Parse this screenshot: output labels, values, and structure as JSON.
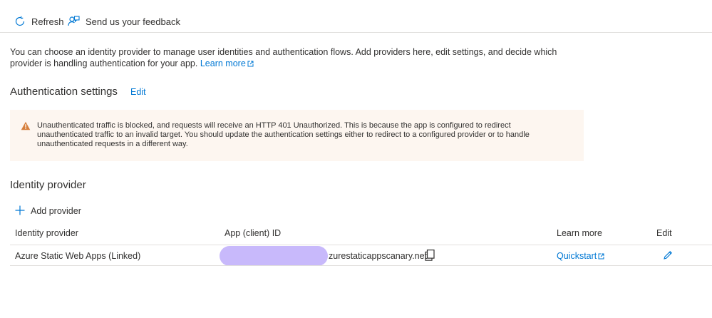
{
  "toolbar": {
    "refresh_label": "Refresh",
    "feedback_label": "Send us your feedback"
  },
  "intro": {
    "text": "You can choose an identity provider to manage user identities and authentication flows. Add providers here, edit settings, and decide which provider is handling authentication for your app.",
    "learn_more_label": "Learn more"
  },
  "auth_settings": {
    "title": "Authentication settings",
    "edit_label": "Edit",
    "warning_text": "Unauthenticated traffic is blocked, and requests will receive an HTTP 401 Unauthorized. This is because the app is configured to redirect unauthenticated traffic to an invalid target. You should update the authentication settings either to redirect to a configured provider or to handle unauthenticated requests in a different way."
  },
  "identity_provider": {
    "title": "Identity provider",
    "add_provider_label": "Add provider",
    "columns": [
      "Identity provider",
      "App (client) ID",
      "Learn more",
      "Edit"
    ],
    "rows": [
      {
        "provider": "Azure Static Web Apps (Linked)",
        "client_id_visible": "zurestaticappscanary.net",
        "learn_more": "Quickstart"
      }
    ]
  },
  "colors": {
    "accent": "#0078d4",
    "warning_bg": "#fdf6f0",
    "warning_icon": "#d67f3c",
    "redaction": "#c8b9fb"
  },
  "icons": {
    "refresh": "refresh-icon",
    "feedback": "feedback-icon",
    "warning": "warning-icon",
    "add": "plus-icon",
    "copy": "copy-icon",
    "edit": "pencil-icon",
    "external": "external-link-icon"
  }
}
